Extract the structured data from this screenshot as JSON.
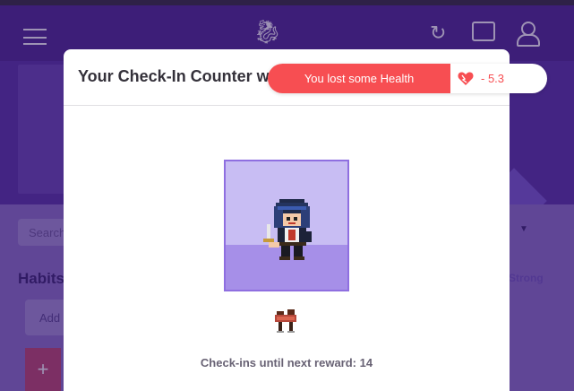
{
  "background": {
    "search_placeholder": "Search",
    "habits_heading": "Habits",
    "strong_label": "Strong",
    "add_label": "Add",
    "plus_label": "+"
  },
  "modal": {
    "title": "Your Check-In Counter went up!",
    "reward_text": "Check-ins until next reward: 14",
    "reward_item_icon": "saddle-icon",
    "avatar_icon": "pixel-avatar-hooded-rogue"
  },
  "toast": {
    "message": "You lost some Health",
    "icon": "heart-icon",
    "value": "- 5.3",
    "accent": "#f74e52"
  },
  "colors": {
    "header": "#4f2a93",
    "avatar_bg": "#c8bdf3",
    "avatar_floor": "#a68fe8",
    "avatar_border": "#8f6fe0"
  }
}
